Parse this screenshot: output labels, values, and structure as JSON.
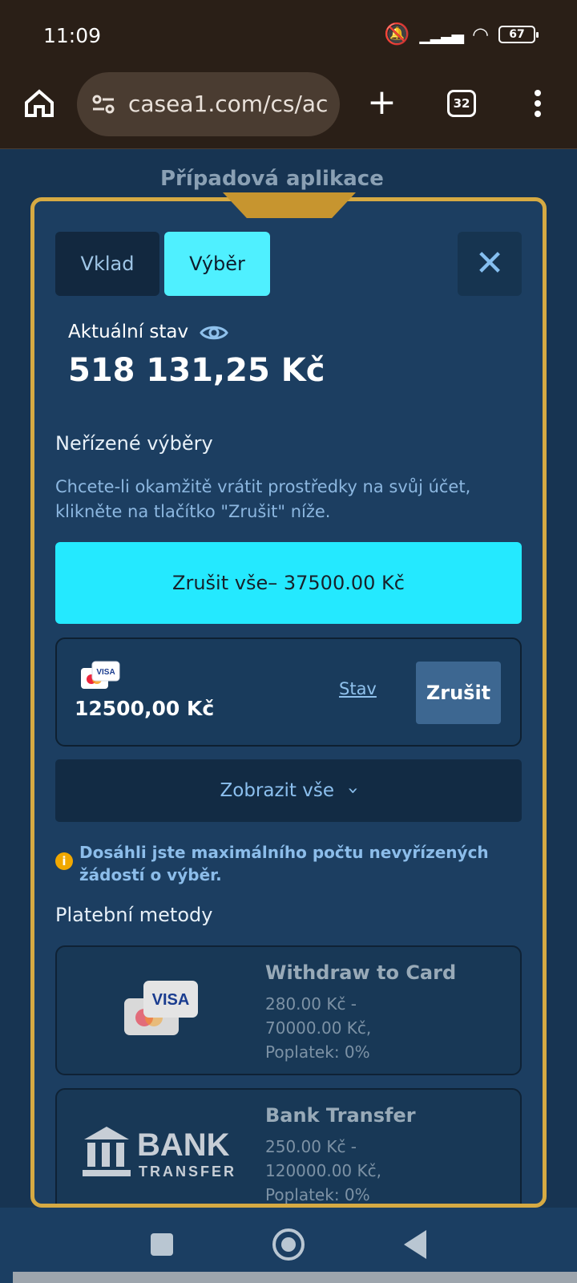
{
  "status_bar": {
    "time": "11:09",
    "battery": "67"
  },
  "browser": {
    "url": "casea1.com/cs/ac",
    "tab_count": "32"
  },
  "page": {
    "background_title": "Případová aplikace"
  },
  "modal": {
    "tabs": [
      "Vklad",
      "Výběr"
    ],
    "balance_label": "Aktuální stav",
    "balance_value": "518 131,25 Kč",
    "pending_title": "Neřízené výběry",
    "pending_description": "Chcete-li okamžitě vrátit prostředky na svůj účet, klikněte na tlačítko \"Zrušit\" níže.",
    "cancel_all_label": "Zrušit vše– 37500.00 Kč",
    "request": {
      "amount": "12500,00 Kč",
      "status_link": "Stav",
      "cancel_label": "Zrušit",
      "card_brand": "VISA"
    },
    "show_all_label": "Zobrazit vše",
    "warning_text": "Dosáhli jste maximálního počtu nevyřízených žádostí o výběr.",
    "payment_methods_title": "Platební metody",
    "payment_methods": [
      {
        "name": "Withdraw to Card",
        "range_line_1": "280.00 Kč -",
        "range_line_2": "70000.00 Kč,",
        "fee": "Poplatek: 0%",
        "icon_label": "VISA"
      },
      {
        "name": "Bank Transfer",
        "range_line_1": "250.00 Kč -",
        "range_line_2": "120000.00 Kč,",
        "fee": "Poplatek: 0%",
        "icon_label": "BANK",
        "icon_sub_label": "TRANSFER"
      }
    ]
  },
  "colors": {
    "accent": "#24e9ff",
    "modal_background": "#1c3e61",
    "gold_frame": "#d6aa43",
    "warning": "#f1a800"
  }
}
